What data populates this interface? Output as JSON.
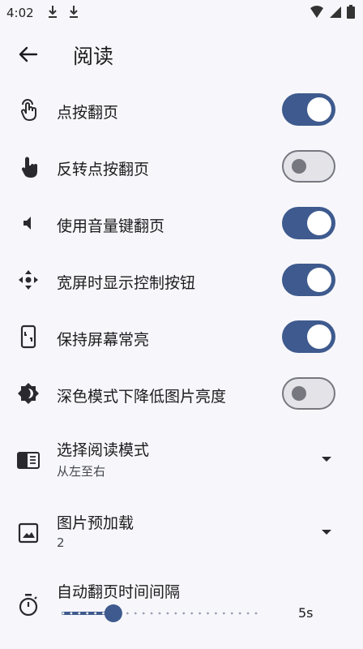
{
  "status": {
    "time": "4:02"
  },
  "header": {
    "title": "阅读"
  },
  "toggles": [
    {
      "label": "点按翻页",
      "on": true,
      "icon": "tap-icon"
    },
    {
      "label": "反转点按翻页",
      "on": false,
      "icon": "touch-icon"
    },
    {
      "label": "使用音量键翻页",
      "on": true,
      "icon": "volume-icon"
    },
    {
      "label": "宽屏时显示控制按钮",
      "on": true,
      "icon": "move-icon"
    },
    {
      "label": "保持屏幕常亮",
      "on": true,
      "icon": "screen-lock-icon"
    },
    {
      "label": "深色模式下降低图片亮度",
      "on": false,
      "icon": "brightness-icon"
    }
  ],
  "selects": [
    {
      "label": "选择阅读模式",
      "value": "从左至右",
      "icon": "reading-mode-icon"
    },
    {
      "label": "图片预加载",
      "value": "2",
      "icon": "image-icon"
    }
  ],
  "slider": {
    "label": "自动翻页时间间隔",
    "value_text": "5s",
    "fraction": 0.26,
    "icon": "timer-icon"
  },
  "colors": {
    "accent": "#3e5a8e",
    "background": "#f7f7fb",
    "off_track": "#e3e3e8",
    "off_outline": "#76777f"
  }
}
